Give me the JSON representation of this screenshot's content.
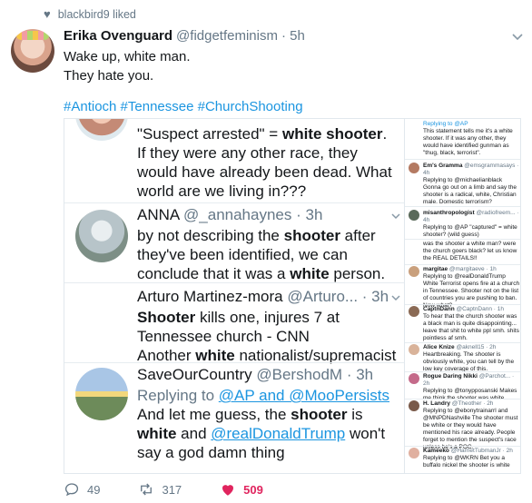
{
  "liked_by": "blackbird9 liked",
  "tweet": {
    "name": "Erika Ovenguard",
    "handle": "@fidgetfeminism",
    "time": "· 5h",
    "line1": "Wake up, white man.",
    "line2": "They hate you.",
    "hashtags": [
      "#Antioch",
      "#Tennessee",
      "#ChurchShooting"
    ]
  },
  "zoom": {
    "t1": {
      "l1a": "\"Suspect arrested\" = ",
      "l1b": "white shooter",
      "l1c": ".",
      "l2": "If they were any other race, they would have already been dead. What world are we living in???"
    },
    "t2": {
      "name": "ANNA",
      "handle": "@_annahaynes · 3h",
      "a": "by not describing the ",
      "b": "shooter",
      "c": " after they've been identified, we can conclude that it was a ",
      "d": "white",
      "e": " person."
    },
    "t3": {
      "name": "Arturo Martinez-mora",
      "handle": "@Arturo... · 3h",
      "a": "Shooter",
      "b": " kills one, injures 7 at Tennessee church - CNN",
      "c": "Another ",
      "d": "white",
      "e": " nationalist/supremacist"
    },
    "t4": {
      "name": "SaveOurCountry",
      "handle": "@BershodM · 3h",
      "replying": "Replying to ",
      "replying_to": "@AP and @MooPersists",
      "a": "And let me guess, the ",
      "b": "shooter",
      "c": " is ",
      "d": "white",
      "e": " and ",
      "f": "@realDonaldTrump",
      "g": " won't say a god damn thing"
    }
  },
  "side": [
    {
      "name": "",
      "meta": "Replying to @AP",
      "text": "This statement tells me it's a white shooter. If it was any other, they would have identified gunman as \"thug, black, terrorist\"."
    },
    {
      "name": "Em's Gramma",
      "meta": "@emsgrammasays · 4h",
      "text": "Replying to @michaelianblack\nGonna go out on a limb and say the shooter is a radical, white, Christian male. Domestic terrorism?"
    },
    {
      "name": "misanthropologist",
      "meta": "@radiofreem... · 4h",
      "text": "Replying to @AP\n\"captured\" = white shooter? (wild guess)"
    },
    {
      "name": "",
      "meta": "",
      "text": "was the shooter a white man? were the church goers black? let us know the REAL DETAILS!!"
    },
    {
      "name": "margitae",
      "meta": "@margitaeve · 1h",
      "text": "Replying to @realDonaldTrump White Terrorist opens fire at a church in Tennessee. Shooter not on the list of countries you are pushing to ban. Now what?"
    },
    {
      "name": "CaptnDann",
      "meta": "@CaptnDann · 1h",
      "text": "To hear that the church shooter was a black man is quite disappointing... leave that shit to white ppl smh. shits pointless af smh."
    },
    {
      "name": "Alice Knize",
      "meta": "@aknell15 · 2h",
      "text": "Heartbreaking. The shooter is obviously white, you can tell by the low key coverage of this."
    },
    {
      "name": "Rogue Daring Nikki",
      "meta": "@Parchot... · 2h",
      "text": "Replying to @tonypposanski\nMakes me think the shooter was white"
    },
    {
      "name": "H. Landry",
      "meta": "@Theother · 2h",
      "text": "Replying to @ebonytrainarrl and @MNPDNashville\nThe shooter must be white or they would have mentioned his race already. People forget to mention the suspect's race unless he's a POC."
    },
    {
      "name": "Kameeko",
      "meta": "@HarrietTubmanJr · 2h",
      "text": "Replying to @WKRN\nBet you a buffalo nickel the shooter is white"
    }
  ],
  "actions": {
    "replies": "49",
    "retweets": "317",
    "likes": "509"
  }
}
